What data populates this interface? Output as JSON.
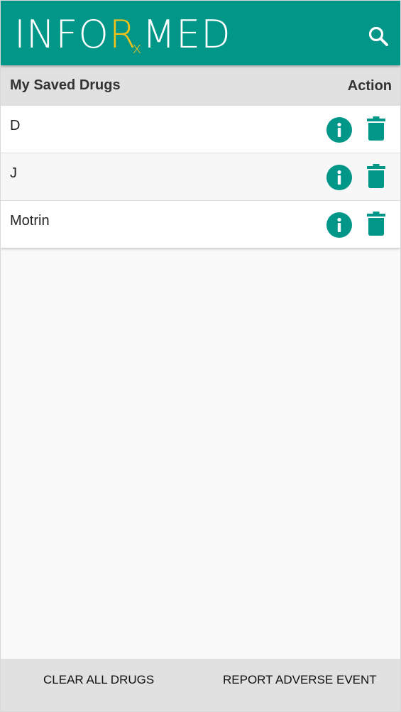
{
  "app": {
    "logo_prefix": "INFO",
    "logo_rx": "R",
    "logo_rx_sub": "x",
    "logo_suffix": "MED",
    "accent_color": "#009688",
    "rx_color": "#f2c21a"
  },
  "toolbar": {
    "search_icon": "search-icon"
  },
  "list_header": {
    "title": "My Saved Drugs",
    "action": "Action"
  },
  "drugs": [
    {
      "name": "D"
    },
    {
      "name": "J"
    },
    {
      "name": "Motrin"
    }
  ],
  "row_icons": {
    "info": "info-icon",
    "delete": "trash-icon"
  },
  "footer": {
    "clear_label": "CLEAR ALL DRUGS",
    "report_label": "REPORT ADVERSE EVENT"
  }
}
